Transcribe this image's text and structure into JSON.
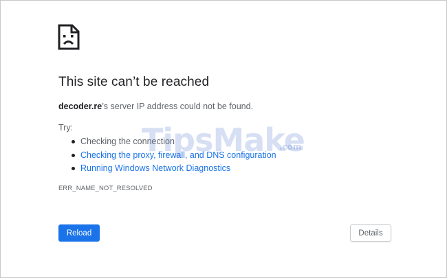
{
  "error_page": {
    "icon": "sad-document-icon",
    "title": "This site can’t be reached",
    "subtitle_host": "decoder.re",
    "subtitle_rest": "’s server IP address could not be found.",
    "try_label": "Try:",
    "suggestions": [
      {
        "label": "Checking the connection",
        "is_link": false
      },
      {
        "label": "Checking the proxy, firewall, and DNS configuration",
        "is_link": true
      },
      {
        "label": "Running Windows Network Diagnostics",
        "is_link": true
      }
    ],
    "error_code": "ERR_NAME_NOT_RESOLVED",
    "reload_label": "Reload",
    "details_label": "Details"
  },
  "watermark": {
    "text": "TipsMake",
    "suffix": ".com"
  },
  "colors": {
    "link": "#1a73e8",
    "primary_button": "#1a73e8",
    "title_text": "#202124",
    "body_text": "#5f6368"
  }
}
